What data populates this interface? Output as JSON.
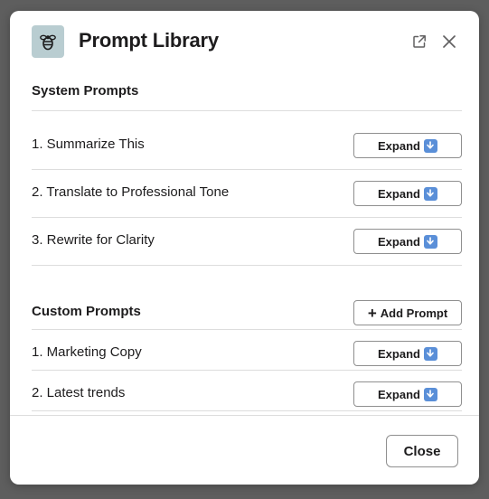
{
  "header": {
    "title": "Prompt Library",
    "app_icon": "bee-icon",
    "popout_icon": "external-link-icon",
    "close_icon": "close-icon"
  },
  "system_prompts": {
    "title": "System Prompts",
    "items": [
      {
        "label": "1. Summarize This",
        "button": "Expand"
      },
      {
        "label": "2. Translate to Professional Tone",
        "button": "Expand"
      },
      {
        "label": "3. Rewrite for Clarity",
        "button": "Expand"
      }
    ]
  },
  "custom_prompts": {
    "title": "Custom Prompts",
    "add_button": "Add Prompt",
    "items": [
      {
        "label": "1. Marketing Copy",
        "button": "Expand"
      },
      {
        "label": "2. Latest trends",
        "button": "Expand"
      }
    ]
  },
  "footer": {
    "close_label": "Close"
  },
  "colors": {
    "overlay": "#5e5e5e",
    "icon_bg": "#b9cdd1",
    "expand_arrow": "#5a8fd8"
  }
}
